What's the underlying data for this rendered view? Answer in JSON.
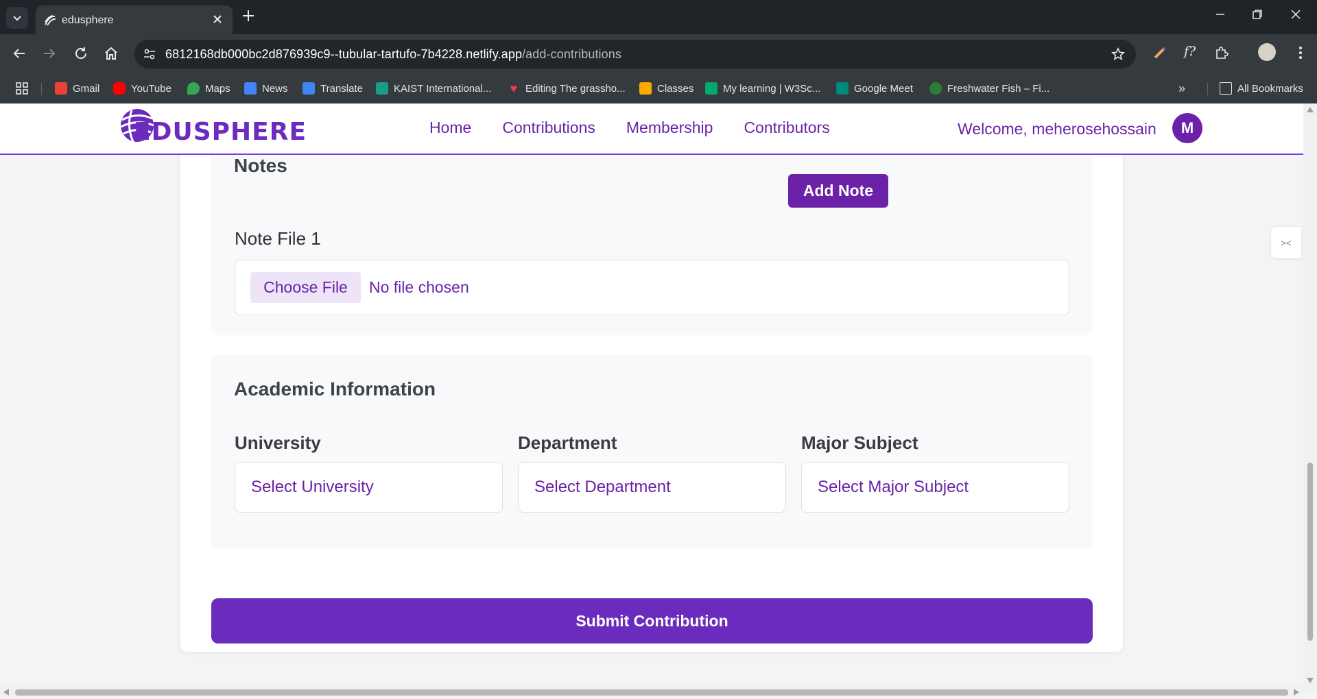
{
  "browser": {
    "tab_title": "edusphere",
    "url_host": "6812168db000bc2d876939c9--tubular-tartufo-7b4228.netlify.app",
    "url_path": "/add-contributions",
    "bookmarks": [
      {
        "label": "Gmail",
        "icon": "gmail-icon",
        "color": "#ea4335"
      },
      {
        "label": "YouTube",
        "icon": "youtube-icon",
        "color": "#ff0000"
      },
      {
        "label": "Maps",
        "icon": "maps-icon",
        "color": "#34a853"
      },
      {
        "label": "News",
        "icon": "news-icon",
        "color": "#4285f4"
      },
      {
        "label": "Translate",
        "icon": "translate-icon",
        "color": "#4285f4"
      },
      {
        "label": "KAIST International...",
        "icon": "kaist-icon",
        "color": "#1a9c8a"
      },
      {
        "label": "Editing The grassho...",
        "icon": "heart-icon",
        "color": "#e53e5a"
      },
      {
        "label": "Classes",
        "icon": "classroom-icon",
        "color": "#f9ab00"
      },
      {
        "label": "My learning | W3Sc...",
        "icon": "w3schools-icon",
        "color": "#04aa6d"
      },
      {
        "label": "Google Meet",
        "icon": "meet-icon",
        "color": "#00897b"
      },
      {
        "label": "Freshwater Fish – Fi...",
        "icon": "fish-icon",
        "color": "#2e7d32"
      }
    ],
    "all_bookmarks": "All Bookmarks"
  },
  "site": {
    "logo_text": "EDUSPHERE",
    "nav": [
      "Home",
      "Contributions",
      "Membership",
      "Contributors"
    ],
    "welcome": "Welcome, meherosehossain",
    "avatar_initial": "M",
    "brand_color": "#6b21a8"
  },
  "notes": {
    "title": "Notes",
    "add_button": "Add Note",
    "file_label": "Note File 1",
    "choose_button": "Choose File",
    "no_file": "No file chosen"
  },
  "academic": {
    "title": "Academic Information",
    "university_label": "University",
    "university_value": "Select University",
    "department_label": "Department",
    "department_value": "Select Department",
    "major_label": "Major Subject",
    "major_value": "Select Major Subject"
  },
  "submit_label": "Submit Contribution",
  "side_tab": "><"
}
